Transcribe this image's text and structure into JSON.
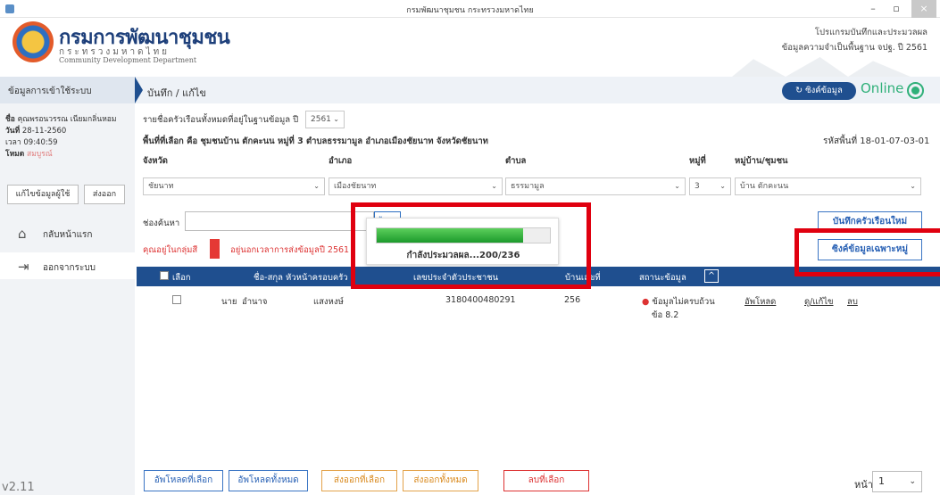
{
  "window": {
    "title": "กรมพัฒนาชุมชน กระทรวงมหาดไทย",
    "minimize": "–",
    "maximize": "▫",
    "close": "×"
  },
  "header": {
    "org_thai": "กรมการพัฒนาชุมชน",
    "org_sub": "กระทรวงมหาดไทย",
    "org_en": "Community Development Department",
    "program_line1": "โปรแกรมบันทึกและประมวลผล",
    "program_line2": "ข้อมูลความจำเป็นพื้นฐาน จปฐ. ปี 2561"
  },
  "sidebar": {
    "section_title": "ข้อมูลการเข้าใช้ระบบ",
    "user_label": "ชื่อ",
    "user_name": "คุณพรอนวรรณ เนียมกลิ่นหอม",
    "date_label": "วันที่",
    "date": "28-11-2560",
    "time_label": "เวลา",
    "time": "09:40:59",
    "mode_label": "โหมด",
    "mode": "สมบูรณ์",
    "edit_user_button": "แก้ไขข้อมูลผู้ใช้",
    "export_button": "ส่งออก",
    "nav": [
      {
        "label": "กลับหน้าแรก",
        "icon": "⌂"
      },
      {
        "label": "ออกจากระบบ",
        "icon": "⇥"
      }
    ],
    "version": "v2.11"
  },
  "topbar": {
    "breadcrumb": "บันทึก / แก้ไข",
    "sync_button": "ซิงค์ข้อมูล",
    "sync_icon": "↻",
    "status": "Online"
  },
  "filter": {
    "year_prefix": "รายชื่อครัวเรือนทั้งหมดที่อยู่ในฐานข้อมูล ปี",
    "year": "2561",
    "area_text": "พื้นที่ที่เลือก คือ ชุมชนบ้าน ตักคะนน หมู่ที่ 3 ตำบลธรรมามูล อำเภอเมืองชัยนาท จังหวัดชัยนาท",
    "area_code": "รหัสพื้นที่ 18-01-07-03-01",
    "province_label": "จังหวัด",
    "province": "ชัยนาท",
    "district_label": "อำเภอ",
    "district": "เมืองชัยนาท",
    "subdistrict_label": "ตำบล",
    "subdistrict": "ธรรมามูล",
    "moo_label": "หมู่ที่",
    "moo": "3",
    "village_label": "หมู่บ้าน/ชุมชน",
    "village": "บ้าน ตักคะนน"
  },
  "search": {
    "label": "ช่องค้นหา",
    "button": "ค้นหา",
    "group_text": "คุณอยู่ในกลุ่มสี",
    "deadline_text": "อยู่นอกเวลาการส่งข้อมูลปี 2561"
  },
  "actions": {
    "new_household": "บันทึกครัวเรือนใหม่",
    "sync_by_moo": "ซิงค์ข้อมูลเฉพาะหมู่"
  },
  "table": {
    "headers": [
      "เลือก",
      "ชื่อ-สกุล หัวหน้าครอบครัว",
      "เลขประจำตัวประชาชน",
      "บ้านเลขที่",
      "สถานะข้อมูล"
    ],
    "sort_icon": "^",
    "rows": [
      {
        "title": "นาย",
        "first": "อำนาจ",
        "last": "แสงหงษ์",
        "id": "3180400480291",
        "house": "256",
        "status_line1": "ข้อมูลไม่ครบถ้วน",
        "status_line2": "ข้อ 8.2",
        "upload": "อัพโหลด",
        "edit": "ดู/แก้ไข",
        "delete": "ลบ"
      }
    ]
  },
  "progress": {
    "text": "กำลังประมวลผล...200/236",
    "fraction": 0.847
  },
  "footer": {
    "upload_selected": "อัพโหลดที่เลือก",
    "upload_all": "อัพโหลดทั้งหมด",
    "export_selected": "ส่งออกที่เลือก",
    "export_all": "ส่งออกทั้งหมด",
    "delete_selected": "ลบที่เลือก",
    "page_label": "หน้า",
    "page": "1"
  },
  "colors": {
    "primary": "#1f4f8f",
    "online": "#2fb079",
    "alert_red": "#e53935",
    "highlight_box": "#e0000f"
  }
}
